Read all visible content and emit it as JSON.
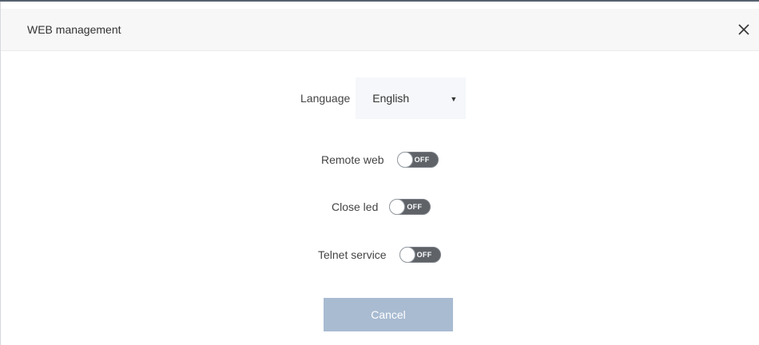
{
  "dialog": {
    "title": "WEB management"
  },
  "language": {
    "label": "Language",
    "selected": "English"
  },
  "remote_web": {
    "label": "Remote web",
    "state": "OFF"
  },
  "close_led": {
    "label": "Close led",
    "state": "OFF"
  },
  "telnet_service": {
    "label": "Telnet service",
    "state": "OFF"
  },
  "buttons": {
    "cancel": "Cancel"
  },
  "icons": {
    "close": "close-icon",
    "dropdown": "dropdown-arrow-icon"
  },
  "colors": {
    "cancel_button": "#a8bbd1",
    "toggle_off": "#5f6368",
    "header_bg": "#f7f7f7",
    "select_bg": "#f5f7fa"
  }
}
